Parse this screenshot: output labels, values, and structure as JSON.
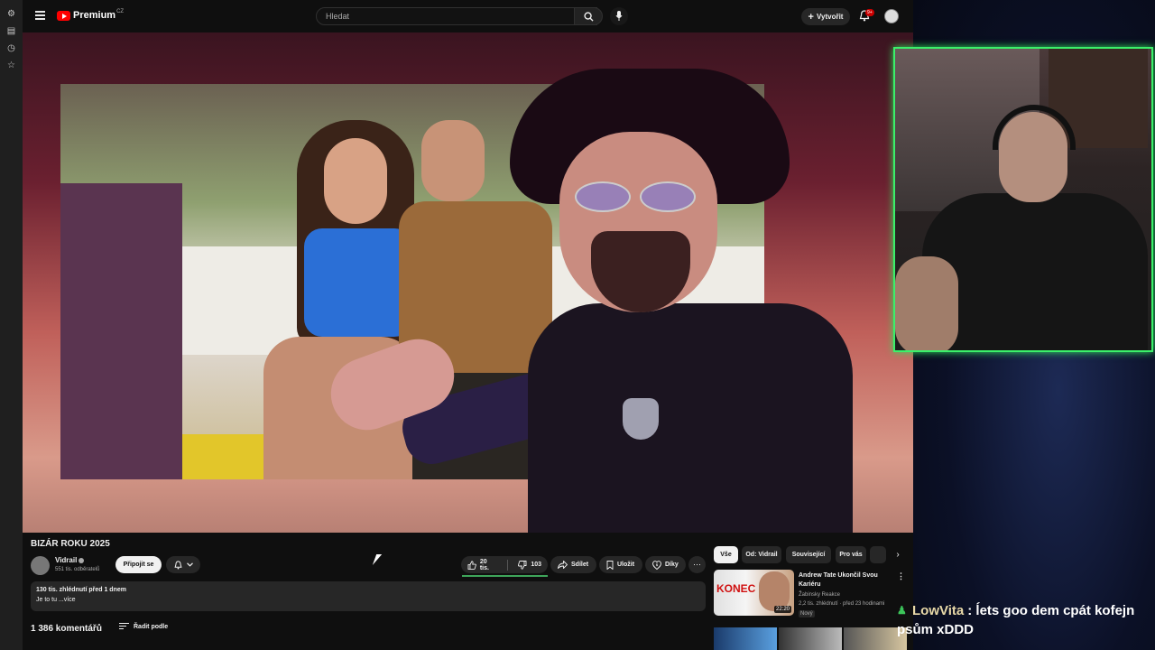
{
  "topbar": {
    "logo_text": "Premium",
    "logo_region": "CZ",
    "search_placeholder": "Hledat",
    "create_label": "Vytvořit",
    "notifications_badge": "9+"
  },
  "video": {
    "title": "BIZÁR ROKU 2025"
  },
  "channel": {
    "name": "Vidrail",
    "subscribers": "551 tis. odběratelů",
    "join_label": "Připojit se"
  },
  "actions": {
    "likes": "20 tis.",
    "dislikes": "103",
    "share": "Sdílet",
    "save": "Uložit",
    "thanks": "Díky"
  },
  "description": {
    "meta": "130 tis. zhlédnutí  před 1 dnem",
    "text": "Je to tu ...více"
  },
  "comments": {
    "count": "1 386 komentářů",
    "sort_label": "Řadit podle"
  },
  "chips": [
    {
      "label": "Vše"
    },
    {
      "label": "Od: Vidrail"
    },
    {
      "label": "Související"
    },
    {
      "label": "Pro vás"
    }
  ],
  "recommendation": {
    "thumb_text": "KONEC",
    "duration": "22:20",
    "title": "Andrew Tate Ukončil Svou Kariéru",
    "channel": "Žabinsky Reakce",
    "stats": "2,2 tis. zhlédnutí  · před 23 hodinami",
    "badge": "Nový"
  },
  "chat": {
    "user": "LowVita",
    "message_line1": " : ĺets goo dem cpát kofejn",
    "message_line2": "psům xDDD"
  },
  "colors": {
    "accent_green": "#3bf06a",
    "brand_red": "#ff0000",
    "bg": "#0f0f0f"
  }
}
